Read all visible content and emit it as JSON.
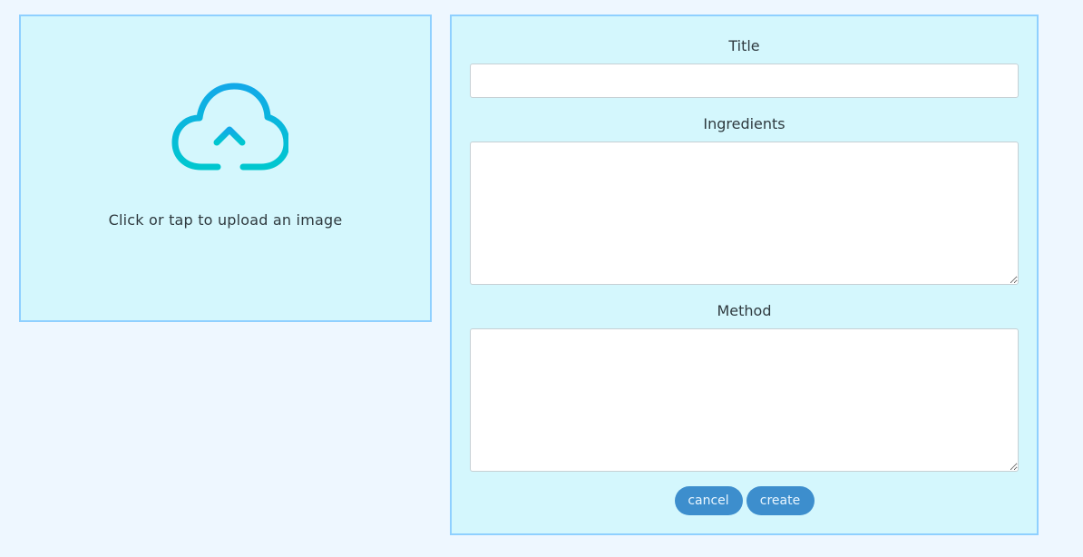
{
  "upload": {
    "prompt": "Click or tap to upload an image",
    "icon": "cloud-upload-icon",
    "icon_color_top": "#12a9e8",
    "icon_color_bottom": "#00c7cf"
  },
  "form": {
    "title_label": "Title",
    "title_value": "",
    "ingredients_label": "Ingredients",
    "ingredients_value": "",
    "method_label": "Method",
    "method_value": ""
  },
  "actions": {
    "cancel_label": "cancel",
    "create_label": "create"
  },
  "colors": {
    "page_background": "#eef7ff",
    "panel_background": "#d4f7fd",
    "panel_border": "#8fd0ff",
    "button_background": "#3d8ecd",
    "button_text": "#e9f6ff"
  }
}
